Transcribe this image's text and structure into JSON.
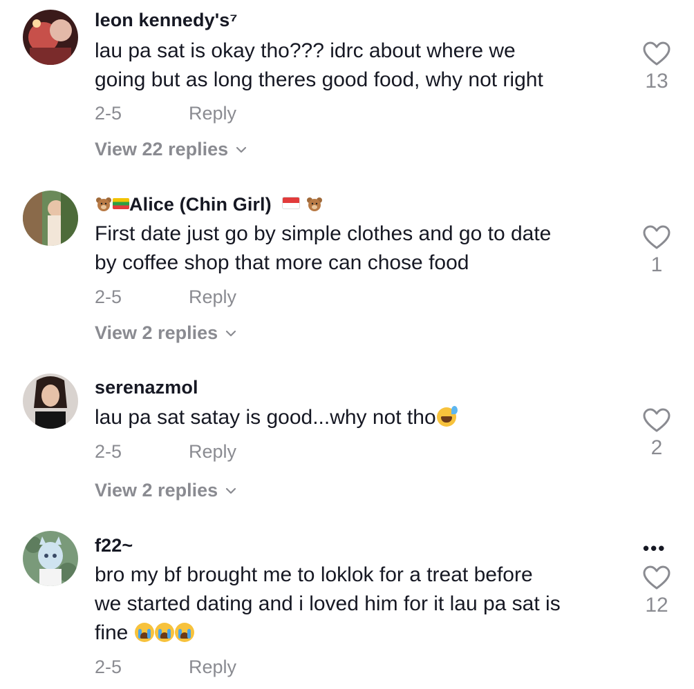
{
  "comments": [
    {
      "username": "leon kennedy's⁷",
      "text_lines": [
        "lau pa sat is okay tho??? idrc about where we",
        "going but as long theres good food, why not right"
      ],
      "date": "2-5",
      "reply_label": "Reply",
      "view_replies": "View 22 replies",
      "likes": "13"
    },
    {
      "username_prefix_icons": [
        "bear-emoji",
        "myanmar-flag"
      ],
      "username": "Alice (Chin Girl)",
      "username_suffix_icons": [
        "singapore-flag",
        "bear-emoji"
      ],
      "text_lines": [
        "First date just go by simple clothes and go to date",
        "by coffee shop that more can chose food"
      ],
      "date": "2-5",
      "reply_label": "Reply",
      "view_replies": "View 2 replies",
      "likes": "1"
    },
    {
      "username": "serenazmol",
      "text_lines": [
        "lau pa sat satay is good...why not tho"
      ],
      "text_suffix_icon": "grinning-sweat-emoji",
      "date": "2-5",
      "reply_label": "Reply",
      "view_replies": "View 2 replies",
      "likes": "2"
    },
    {
      "username": "f22~",
      "text_lines": [
        "bro my bf brought me to loklok for a treat before",
        "we started dating and i loved him for it lau pa sat is",
        "fine"
      ],
      "text_suffix_icons": [
        "loudly-crying-emoji",
        "loudly-crying-emoji",
        "loudly-crying-emoji"
      ],
      "date": "2-5",
      "reply_label": "Reply",
      "likes": "12",
      "more_label": "•••"
    }
  ],
  "colors": {
    "primary_text": "#161823",
    "secondary_text": "#8a8b91"
  }
}
